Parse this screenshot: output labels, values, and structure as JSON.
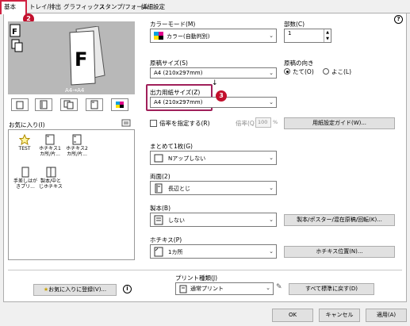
{
  "tabs": [
    {
      "label": "基本"
    },
    {
      "label": "トレイ/排出"
    },
    {
      "label": "グラフィックス"
    },
    {
      "label": "スタンプ/フォーム"
    },
    {
      "label": "詳細設定"
    }
  ],
  "badges": {
    "b2": "2",
    "b3": "3"
  },
  "preview": {
    "caption": "A4→A4"
  },
  "favorites": {
    "title": "お気に入り(I)",
    "items": [
      {
        "label": "TEST"
      },
      {
        "label": "ホチキス1カ所/片..."
      },
      {
        "label": "ホチキス2カ所/片..."
      },
      {
        "label": "手差しはがきプリ..."
      },
      {
        "label": "製本/中とじホチキス"
      }
    ],
    "register_button": "お気に入りに登録(V)..."
  },
  "color_mode": {
    "label": "カラーモード(M)",
    "value": "カラー(自動判別)"
  },
  "copies": {
    "label": "部数(C)",
    "value": "1"
  },
  "original_size": {
    "label": "原稿サイズ(S)",
    "value": "A4 (210x297mm)"
  },
  "orientation": {
    "label": "原稿の向き",
    "options": [
      "たて(O)",
      "よこ(L)"
    ]
  },
  "output_size": {
    "label": "出力用紙サイズ(Z)",
    "value": "A4 (210x297mm)"
  },
  "zoom": {
    "checkbox_label": "倍率を指定する(R)",
    "zoom_label": "倍率(Q)",
    "zoom_value": "100",
    "unit": "%"
  },
  "paper_guide_button": "用紙設定ガイド(W)...",
  "nup": {
    "label": "まとめて1枚(G)",
    "value": "Nアップしない"
  },
  "duplex": {
    "label": "両面(2)",
    "value": "長辺とじ"
  },
  "booklet": {
    "label": "製本(B)",
    "value": "しない"
  },
  "booklet_button": "製本/ポスター/混在原稿/回転(K)...",
  "staple": {
    "label": "ホチキス(P)",
    "value": "1カ所"
  },
  "staple_button": "ホチキス位置(N)...",
  "print_type": {
    "label": "プリント種類(J)",
    "value": "通常プリント"
  },
  "reset_button": "すべて標準に戻す(D)",
  "footer": {
    "ok": "OK",
    "cancel": "キャンセル",
    "apply": "適用(A)"
  },
  "help_glyph": "?",
  "info_glyph": "i",
  "colors": {
    "badge": "#c2102d",
    "highlight": "#a0205a"
  }
}
